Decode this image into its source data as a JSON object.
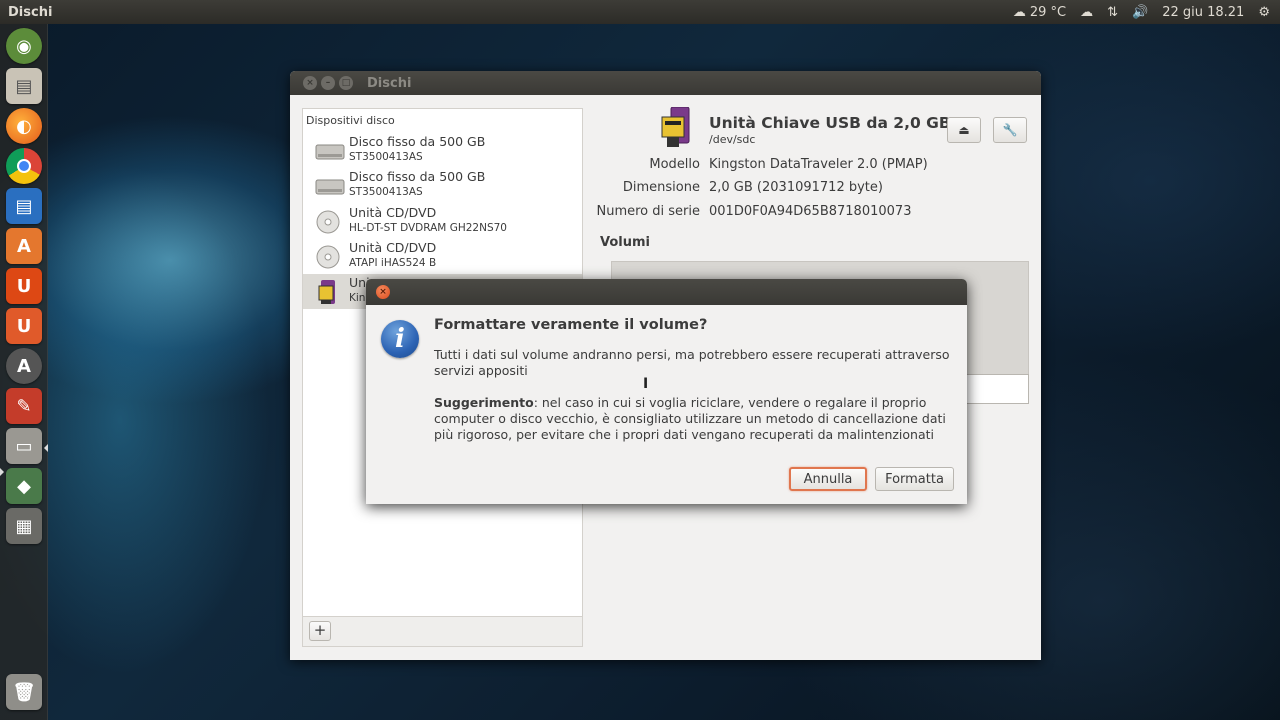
{
  "top_panel": {
    "app_title": "Dischi",
    "temperature": "29 °C",
    "date_time": "22 giu  18.21"
  },
  "launcher": {
    "icons": [
      "dash-icon",
      "files-icon",
      "firefox-icon",
      "chrome-icon",
      "writer-icon",
      "software-center-icon",
      "ubuntu-one-icon",
      "ubuntu-one-music-icon",
      "updates-icon",
      "system-settings-icon",
      "disks-icon",
      "ccsm-icon",
      "workspaces-icon",
      "trash-icon"
    ]
  },
  "window": {
    "title": "Dischi",
    "sidebar": {
      "heading": "Dispositivi disco",
      "devices": [
        {
          "name": "Disco fisso da 500 GB",
          "sub": "ST3500413AS"
        },
        {
          "name": "Disco fisso da 500 GB",
          "sub": "ST3500413AS"
        },
        {
          "name": "Unità CD/DVD",
          "sub": "HL-DT-ST DVDRAM GH22NS70"
        },
        {
          "name": "Unità CD/DVD",
          "sub": "ATAPI  iHAS524  B"
        },
        {
          "name": "Uni",
          "sub": "Kin"
        }
      ],
      "add_label": "+"
    },
    "drive": {
      "title": "Unità Chiave USB da 2,0 GB",
      "path": "/dev/sdc",
      "props": [
        {
          "label": "Modello",
          "value": "Kingston DataTraveler 2.0 (PMAP)"
        },
        {
          "label": "Dimensione",
          "value": "2,0 GB (2031091712 byte)"
        },
        {
          "label": "Numero di serie",
          "value": "001D0F0A94D65B8718010073"
        }
      ],
      "volumes_title": "Volumi"
    }
  },
  "dialog": {
    "heading": "Formattare veramente il volume?",
    "message": "Tutti i dati sul volume andranno persi, ma potrebbero essere recuperati attraverso servizi appositi",
    "hint_bold": "Suggerimento",
    "hint_text": ": nel caso in cui si voglia riciclare, vendere o regalare il proprio computer o disco vecchio, è consigliato utilizzare un metodo di cancellazione dati più rigoroso, per evitare che i propri dati vengano recuperati da malintenzionati",
    "cancel_label": "Annulla",
    "format_label": "Formatta"
  }
}
